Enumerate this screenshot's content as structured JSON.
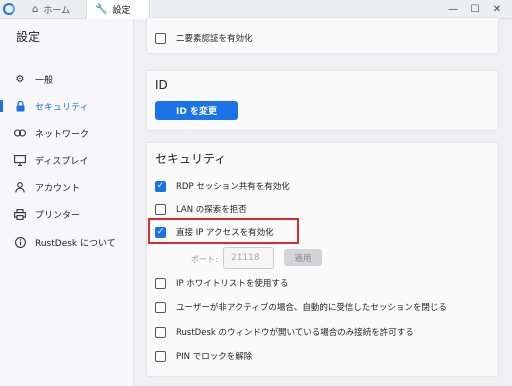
{
  "window": {
    "tabs": [
      {
        "label": "ホーム",
        "icon": "home-icon"
      },
      {
        "label": "設定",
        "icon": "wrench-icon"
      }
    ],
    "controls": {
      "minimize": "—",
      "maximize": "☐",
      "close": "✕"
    }
  },
  "sidebar": {
    "title": "設定",
    "items": [
      {
        "label": "一般",
        "icon": "gear-icon"
      },
      {
        "label": "セキュリティ",
        "icon": "lock-icon",
        "active": true
      },
      {
        "label": "ネットワーク",
        "icon": "link-icon"
      },
      {
        "label": "ディスプレイ",
        "icon": "monitor-icon"
      },
      {
        "label": "アカウント",
        "icon": "person-icon"
      },
      {
        "label": "プリンター",
        "icon": "printer-icon"
      },
      {
        "label": "RustDesk について",
        "icon": "info-icon"
      }
    ]
  },
  "main": {
    "two_factor": {
      "label": "二要素認証を有効化",
      "checked": false
    },
    "id_section": {
      "heading": "ID",
      "button": "ID を変更"
    },
    "security": {
      "heading": "セキュリティ",
      "options": [
        {
          "label": "RDP セッション共有を有効化",
          "checked": true
        },
        {
          "label": "LAN の探索を拒否",
          "checked": false
        },
        {
          "label": "直接 IP アクセスを有効化",
          "checked": true
        },
        {
          "label": "IP ホワイトリストを使用する",
          "checked": false
        },
        {
          "label": "ユーザーが非アクティブの場合、自動的に受信したセッションを閉じる",
          "checked": false
        },
        {
          "label": "RustDesk のウィンドウが開いている場合のみ接続を許可する",
          "checked": false
        },
        {
          "label": "PIN でロックを解除",
          "checked": false
        }
      ],
      "port_label": "ポート:",
      "port_value": "21118",
      "apply_button": "適用"
    }
  },
  "colors": {
    "accent": "#1a73e8",
    "highlight": "#d62d2d"
  }
}
